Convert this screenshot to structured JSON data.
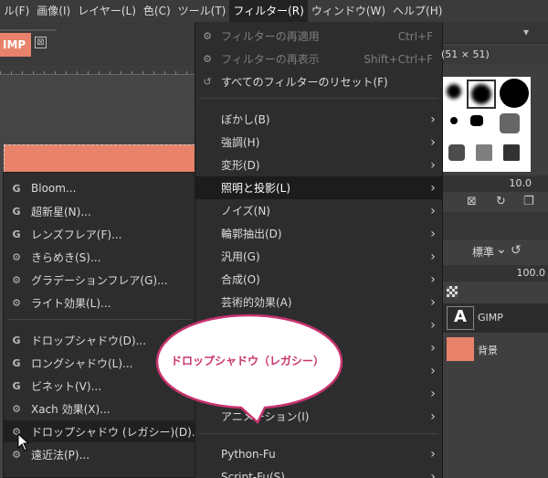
{
  "menubar": {
    "items": [
      "ル(F)",
      "画像(I)",
      "レイヤー(L)",
      "色(C)",
      "ツール(T)",
      "フィルター(R)",
      "ウィンドウ(W)",
      "ヘルプ(H)"
    ],
    "active_index": 5
  },
  "image_tab": {
    "label": "IMP",
    "close_glyph": "⊠"
  },
  "filter_menu": {
    "items": [
      {
        "icon": "repeat-filter-icon",
        "label": "フィルターの再適用",
        "shortcut": "Ctrl+F",
        "disabled": true
      },
      {
        "icon": "reshow-filter-icon",
        "label": "フィルターの再表示",
        "shortcut": "Shift+Ctrl+F",
        "disabled": true
      },
      {
        "icon": "reset-filters-icon",
        "label": "すべてのフィルターのリセット(F)",
        "shortcut": "",
        "disabled": false
      },
      {
        "label": "ぼかし(B)",
        "submenu": true
      },
      {
        "label": "強調(H)",
        "submenu": true
      },
      {
        "label": "変形(D)",
        "submenu": true
      },
      {
        "label": "照明と投影(L)",
        "submenu": true,
        "highlighted": true
      },
      {
        "label": "ノイズ(N)",
        "submenu": true
      },
      {
        "label": "輪郭抽出(D)",
        "submenu": true
      },
      {
        "label": "汎用(G)",
        "submenu": true
      },
      {
        "label": "合成(O)",
        "submenu": true
      },
      {
        "label": "芸術的効果(A)",
        "submenu": true
      },
      {
        "label": "アニメーション(I)",
        "submenu": true
      },
      {
        "label": "Python-Fu",
        "submenu": true
      },
      {
        "label": "Script-Fu(S)",
        "submenu": true
      }
    ]
  },
  "light_shadow_menu": {
    "items": [
      {
        "icon": "G",
        "icon_name": "gegl-icon",
        "label": "Bloom..."
      },
      {
        "icon": "G",
        "icon_name": "gegl-icon",
        "label": "超新星(N)..."
      },
      {
        "icon": "G",
        "icon_name": "gegl-icon",
        "label": "レンズフレア(F)..."
      },
      {
        "icon": "⚙",
        "icon_name": "plugin-icon",
        "label": "きらめき(S)..."
      },
      {
        "icon": "⚙",
        "icon_name": "plugin-icon",
        "label": "グラデーションフレア(G)..."
      },
      {
        "icon": "⚙",
        "icon_name": "plugin-icon",
        "label": "ライト効果(L)..."
      },
      {
        "icon": "G",
        "icon_name": "gegl-icon",
        "label": "ドロップシャドウ(D)..."
      },
      {
        "icon": "G",
        "icon_name": "gegl-icon",
        "label": "ロングシャドウ(L)..."
      },
      {
        "icon": "G",
        "icon_name": "gegl-icon",
        "label": "ビネット(V)..."
      },
      {
        "icon": "⚙",
        "icon_name": "plugin-icon",
        "label": "Xach 効果(X)..."
      },
      {
        "icon": "⚙",
        "icon_name": "plugin-icon",
        "label": "ドロップシャドウ (レガシー)(D)...",
        "highlighted": true
      },
      {
        "icon": "⚙",
        "icon_name": "plugin-icon",
        "label": "遠近法(P)..."
      }
    ]
  },
  "callout": {
    "text": "ドロップシャドウ（レガシー）"
  },
  "dock": {
    "brush_name": "(51 × 51)",
    "brush_size": "10.0",
    "mode": "標準",
    "opacity": "100.0",
    "layers": [
      {
        "thumb_text": "A",
        "name": "GIMP"
      },
      {
        "name": "背景"
      }
    ]
  },
  "colors": {
    "accent": "#e8826a",
    "callout_pink": "#c8336e",
    "menu_bg": "#2d2d2d",
    "highlight_bg": "#1c1c1c"
  }
}
